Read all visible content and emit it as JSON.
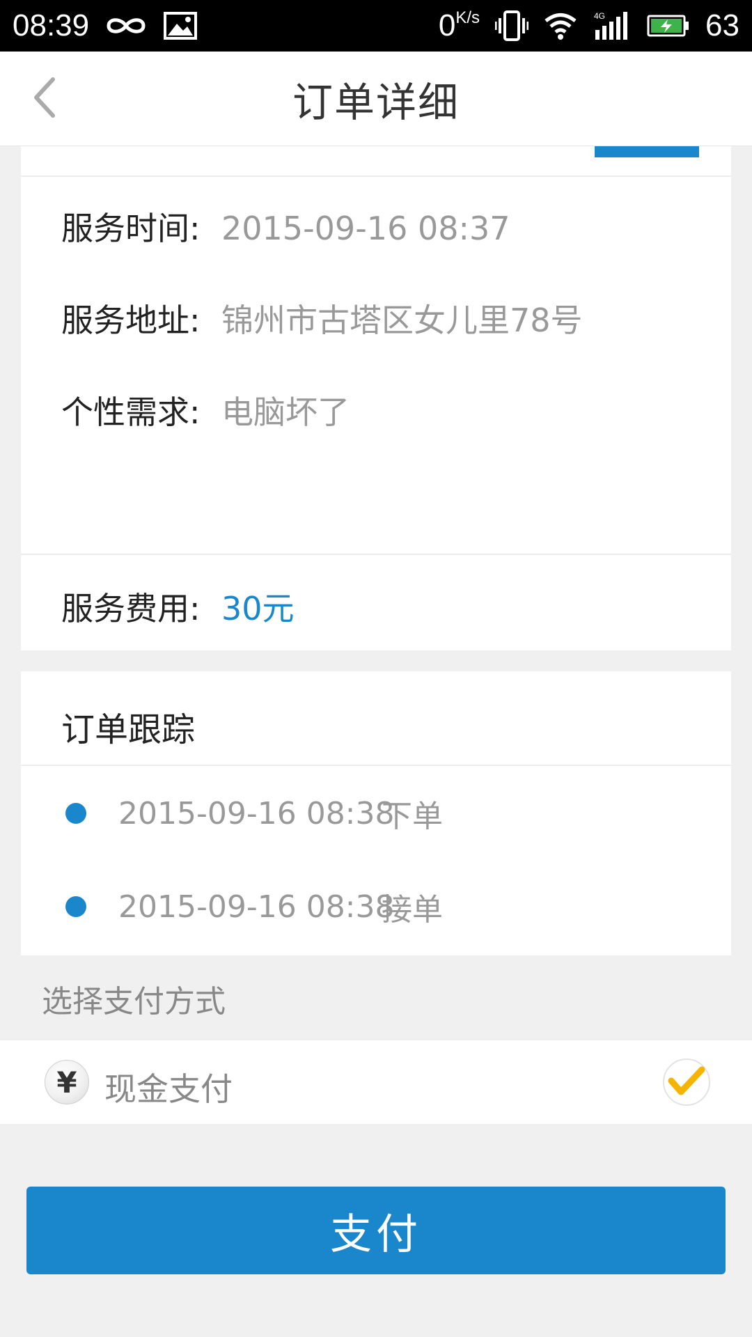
{
  "status_bar": {
    "time": "08:39",
    "speed_value": "0",
    "speed_unit": "K/s",
    "network": "4G",
    "battery": "63",
    "icons": [
      "infinity-icon",
      "image-icon",
      "vibrate-icon",
      "wifi-icon",
      "signal-icon",
      "battery-charging-icon"
    ]
  },
  "header": {
    "title": "订单详细",
    "back_icon": "chevron-left-icon"
  },
  "order": {
    "service_time_label": "服务时间:",
    "service_time_value": "2015-09-16 08:37",
    "service_address_label": "服务地址:",
    "service_address_value": "锦州市古塔区女儿里78号",
    "requirement_label": "个性需求:",
    "requirement_value": "电脑坏了",
    "fee_label": "服务费用:",
    "fee_value": "30元"
  },
  "tracking": {
    "title": "订单跟踪",
    "items": [
      {
        "time": "2015-09-16 08:38",
        "status": "下单"
      },
      {
        "time": "2015-09-16 08:38",
        "status": "接单"
      }
    ]
  },
  "payment": {
    "section_label": "选择支付方式",
    "method_label": "现金支付",
    "method_icon": "yen-icon",
    "selected": true,
    "button_label": "支付"
  },
  "colors": {
    "accent": "#1a87cc",
    "check": "#f5b400"
  }
}
